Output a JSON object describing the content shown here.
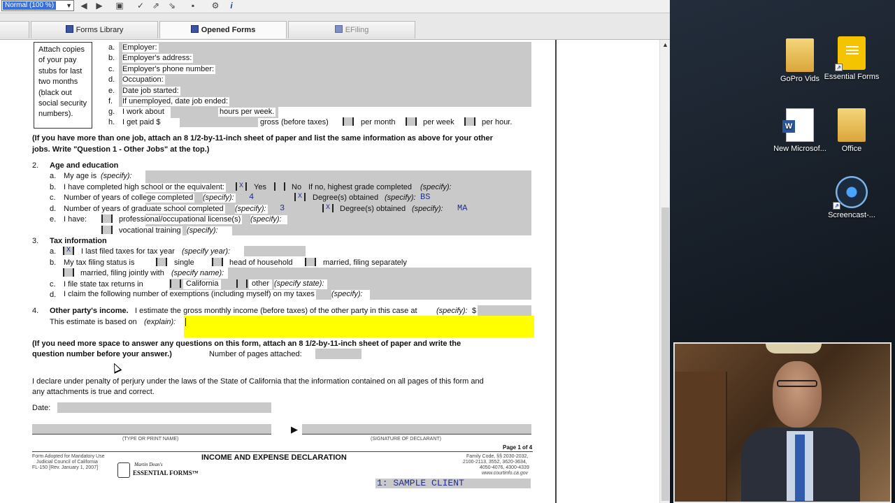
{
  "toolbar": {
    "zoom_value": "Normal (100 %)"
  },
  "tabs": [
    {
      "label": "Forms Library"
    },
    {
      "label": "Opened Forms"
    },
    {
      "label": "EFiling"
    }
  ],
  "form": {
    "attach_note": "Attach copies of your pay stubs for last two months (black out social security numbers).",
    "employment": {
      "a_letter": "a.",
      "a": "Employer:",
      "b_letter": "b.",
      "b": "Employer's address:",
      "c_letter": "c.",
      "c": "Employer's phone number:",
      "d_letter": "d.",
      "d": "Occupation:",
      "e_letter": "e.",
      "e": "Date job started:",
      "f_letter": "f.",
      "f": "If unemployed, date job ended:",
      "g_letter": "g.",
      "g1": "I work about",
      "g2": "hours per week.",
      "h_letter": "h.",
      "h1": "I get paid $",
      "h2": "gross (before taxes)",
      "per_month": "per month",
      "per_week": "per week",
      "per_hour": "per hour."
    },
    "other_jobs_note_1": "(If you have more than one job, attach an 8 1/2-by-11-inch sheet of paper and list the same information as above for your other",
    "other_jobs_note_2": "jobs. Write \"Question 1 - Other Jobs\" at the top.)",
    "section2": {
      "num": "2.",
      "title": "Age and education",
      "a_letter": "a.",
      "a1": "My age is",
      "a2": "(specify):",
      "b_letter": "b.",
      "b1": "I have completed high school or the equivalent:",
      "yes_mark": "X",
      "yes": "Yes",
      "no_mark": "",
      "no": "No",
      "b2": "If no, highest grade completed",
      "b3": "(specify):",
      "c_letter": "c.",
      "c1": "Number of years of college completed",
      "c2": "(specify):",
      "c_value": "4",
      "c_degree_mark": "X",
      "c3": "Degree(s) obtained",
      "c4": "(specify):",
      "c_degree": "BS",
      "d_letter": "d.",
      "d1": "Number of years of graduate school completed",
      "d2": "(specify):",
      "d_value": "3",
      "d_degree_mark": "X",
      "d3": "Degree(s) obtained",
      "d4": "(specify):",
      "d_degree": "MA",
      "e_letter": "e.",
      "e1": "I have:",
      "e2": "professional/occupational license(s)",
      "e3": "(specify):",
      "e4": "vocational training",
      "e5": "(specify):"
    },
    "section3": {
      "num": "3.",
      "title": "Tax information",
      "a_letter": "a.",
      "a_mark": "X",
      "a1": "I last filed taxes for tax year",
      "a2": "(specify year):",
      "b_letter": "b.",
      "b1": "My tax filing status is",
      "single": "single",
      "hoh": "head of household",
      "mfs": "married, filing separately",
      "mfj": "married, filing jointly with",
      "mfj2": "(specify name):",
      "c_letter": "c.",
      "c1": "I file state tax returns in",
      "california": "California",
      "other": "other",
      "other2": "(specify state):",
      "d_letter": "d.",
      "d1": "I claim the following number of exemptions (including myself) on my taxes",
      "d2": "(specify):"
    },
    "section4": {
      "num": "4.",
      "title": "Other party's income.",
      "t1": "I estimate the gross monthly income (before taxes) of the other party in this case at",
      "t2": "(specify):",
      "t3": "$",
      "t4": "This estimate is based on",
      "t5": "(explain):"
    },
    "more_space_1": "(If you need more space to answer any questions on this form, attach an 8 1/2-by-11-inch sheet of paper and write the",
    "more_space_2": "question number before your answer.)",
    "pages_attached": "Number of pages attached:",
    "declare_1": "I declare under penalty of perjury under the laws of the State of California that the information contained on all pages of this form and",
    "declare_2": "any attachments is true and correct.",
    "date_label": "Date:",
    "type_name": "(TYPE OR PRINT NAME)",
    "signature": "(SIGNATURE OF DECLARANT)",
    "page_of": "Page 1 of 4",
    "footer_left_1": "Form Adopted for Mandatory Use",
    "footer_left_2": "Judicial Council of California",
    "footer_left_3": "FL-150 [Rev. January 1, 2007]",
    "brand_1": "Martin Dean's",
    "brand_2": "ESSENTIAL FORMS™",
    "footer_title": "INCOME AND EXPENSE DECLARATION",
    "footer_right_1": "Family Code, §§ 2030-2032,",
    "footer_right_2": "2100-2113, 3552, 3620-3634,",
    "footer_right_3": "4050-4076, 4300-4339",
    "footer_right_4": "www.courtinfo.ca.gov",
    "client": "1: SAMPLE CLIENT"
  },
  "desktop": {
    "icons": [
      {
        "label": "GoPro Vids"
      },
      {
        "label": "Essential Forms"
      },
      {
        "label": "New Microsof..."
      },
      {
        "label": "Office"
      },
      {
        "label": "Screencast-..."
      }
    ]
  }
}
